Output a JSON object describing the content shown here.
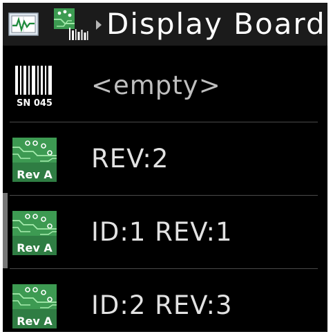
{
  "header": {
    "title": "Display Board",
    "icons": [
      "monitor-chart-icon",
      "board-barcode-icon",
      "breadcrumb-arrow-icon"
    ]
  },
  "list": {
    "items": [
      {
        "label": "<empty>",
        "icon": "barcode-serial-icon",
        "icon_text": "SN 045",
        "muted": true
      },
      {
        "label": "REV:2",
        "icon": "circuit-board-rev-icon",
        "icon_text": "Rev A"
      },
      {
        "label": "ID:1 REV:1",
        "icon": "circuit-board-rev-icon",
        "icon_text": "Rev A"
      },
      {
        "label": "ID:2 REV:3",
        "icon": "circuit-board-rev-icon",
        "icon_text": "Rev A"
      }
    ]
  },
  "colors": {
    "background": "#000000",
    "header_bg": "#1b1b1b",
    "text": "#e2e2e2",
    "board_green": "#3d9a52",
    "scrollbar": "#777777"
  }
}
